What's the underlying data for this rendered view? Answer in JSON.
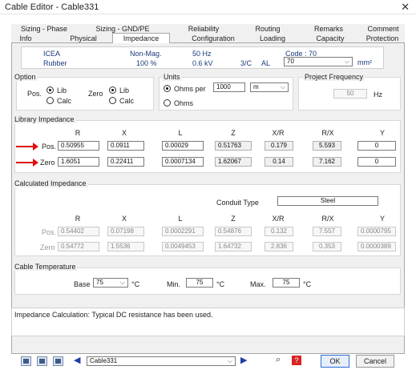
{
  "window": {
    "title": "Cable Editor - Cable331"
  },
  "tabs_row1": [
    "Sizing - Phase",
    "Sizing - GND/PE",
    "Reliability",
    "Routing",
    "Remarks",
    "Comment"
  ],
  "tabs_row2": [
    "Info",
    "Physical",
    "Impedance",
    "Configuration",
    "Loading",
    "Capacity",
    "Protection"
  ],
  "active_tab": "Impedance",
  "info": {
    "standard": "ICEA",
    "magnetic": "Non-Mag.",
    "frequency": "50 Hz",
    "code": "Code : 70",
    "insulation": "Rubber",
    "percent": "100 %",
    "voltage": "0.6 kV",
    "conductors": "3/C",
    "material": "AL",
    "size": "70",
    "size_unit": "mm²"
  },
  "option": {
    "label": "Option",
    "pos_label": "Pos.",
    "zero_label": "Zero",
    "lib": "Lib",
    "calc": "Calc"
  },
  "units": {
    "label": "Units",
    "ohms_per": "Ohms per",
    "length": "1000",
    "length_unit": "m",
    "ohms": "Ohms"
  },
  "project_frequency": {
    "label": "Project Frequency",
    "value": "50",
    "unit": "Hz"
  },
  "library_impedance": {
    "label": "Library Impedance",
    "columns": [
      "R",
      "X",
      "L",
      "Z",
      "X/R",
      "R/X",
      "Y"
    ],
    "rows": [
      {
        "label": "Pos.",
        "values": [
          "0.50955",
          "0.0911",
          "0.00029",
          "0.51763",
          "0.179",
          "5.593",
          "0"
        ]
      },
      {
        "label": "Zero",
        "values": [
          "1.6051",
          "0.22411",
          "0.0007134",
          "1.62067",
          "0.14",
          "7.162",
          "0"
        ]
      }
    ]
  },
  "calculated_impedance": {
    "label": "Calculated Impedance",
    "conduit_label": "Conduit Type",
    "conduit_value": "Steel",
    "columns": [
      "R",
      "X",
      "L",
      "Z",
      "X/R",
      "R/X",
      "Y"
    ],
    "rows": [
      {
        "label": "Pos.",
        "values": [
          "0.54402",
          "0.07198",
          "0.0002291",
          "0.54876",
          "0.132",
          "7.557",
          "0.0000795"
        ]
      },
      {
        "label": "Zero",
        "values": [
          "0.54772",
          "1.5536",
          "0.0049453",
          "1.64732",
          "2.836",
          "0.353",
          "0.0000389"
        ]
      }
    ]
  },
  "cable_temperature": {
    "label": "Cable Temperature",
    "base_label": "Base",
    "base_value": "75",
    "min_label": "Min.",
    "min_value": "75",
    "max_label": "Max.",
    "max_value": "75",
    "unit": "°C"
  },
  "status_message": "Impedance Calculation: Typical DC resistance has been used.",
  "footer": {
    "cable_select": "Cable331",
    "ok": "OK",
    "cancel": "Cancel"
  }
}
